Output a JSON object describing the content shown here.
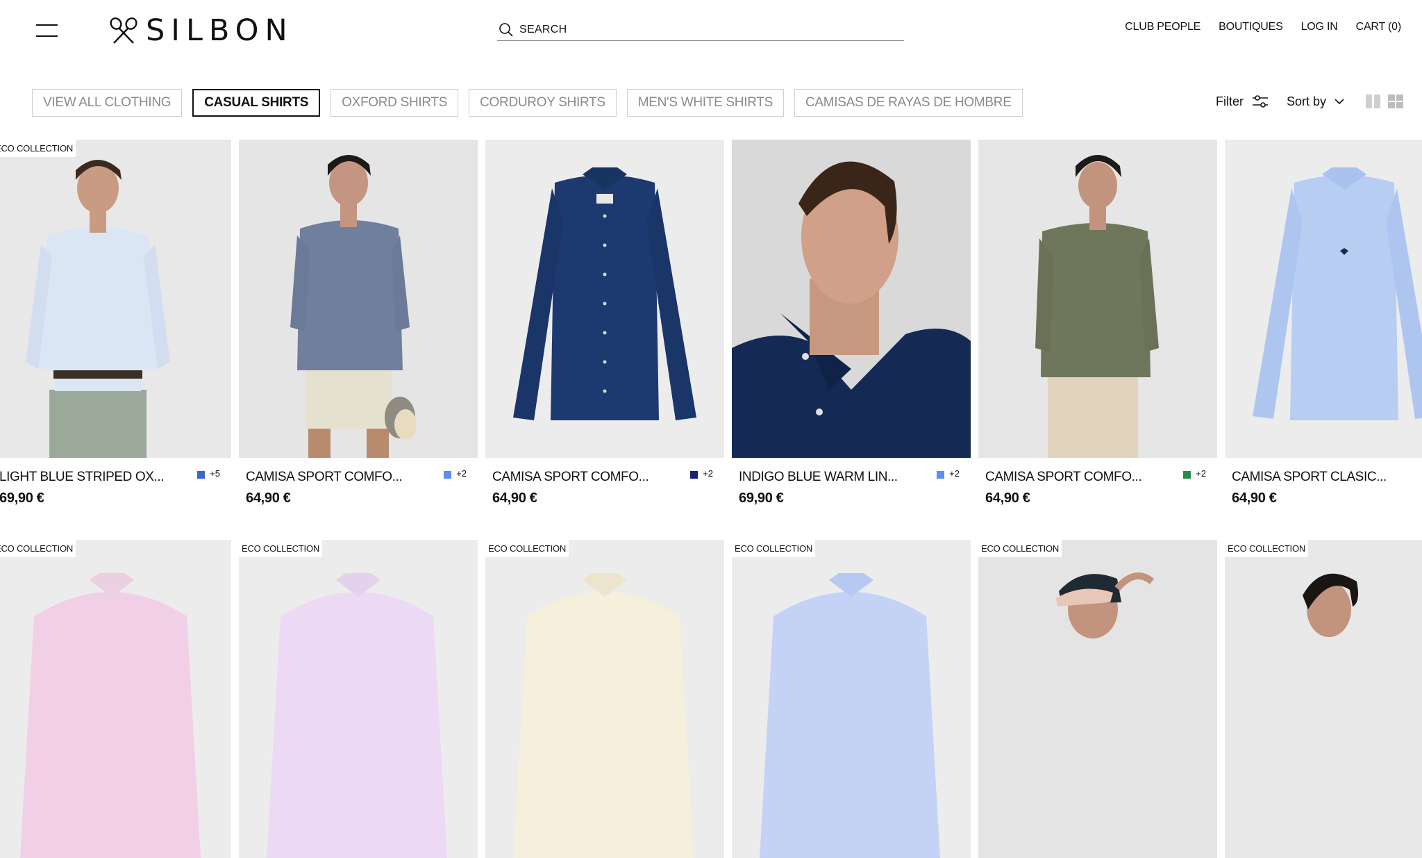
{
  "header": {
    "brand": "SILBON",
    "search_placeholder": "SEARCH",
    "nav": [
      "CLUB PEOPLE",
      "BOUTIQUES",
      "LOG IN",
      "CART (0)"
    ]
  },
  "filters": {
    "tabs": [
      "VIEW ALL CLOTHING",
      "CASUAL SHIRTS",
      "OXFORD SHIRTS",
      "CORDUROY SHIRTS",
      "MEN'S WHITE SHIRTS",
      "CAMISAS DE RAYAS DE HOMBRE"
    ],
    "active_tab": "CASUAL SHIRTS",
    "filter_label": "Filter",
    "sort_label": "Sort by"
  },
  "badge_label": "ECO COLLECTION",
  "products_row1": [
    {
      "name": "LIGHT BLUE STRIPED OX...",
      "price": "69,90 €",
      "swatch": "#3b64d8",
      "more": "+5",
      "badge": true,
      "image": "man-light-blue-striped-shirt"
    },
    {
      "name": "CAMISA SPORT COMFO...",
      "price": "64,90 €",
      "swatch": "#5b8ff0",
      "more": "+2",
      "badge": false,
      "image": "man-blue-linen-shirt-shorts"
    },
    {
      "name": "CAMISA SPORT COMFO...",
      "price": "64,90 €",
      "swatch": "#1a1f70",
      "more": "+2",
      "badge": false,
      "image": "navy-shirt-flatlay"
    },
    {
      "name": "INDIGO BLUE WARM LIN...",
      "price": "69,90 €",
      "swatch": "#5b8ff0",
      "more": "+2",
      "badge": false,
      "image": "man-indigo-shirt-closeup"
    },
    {
      "name": "CAMISA SPORT COMFO...",
      "price": "64,90 €",
      "swatch": "#2e8b47",
      "more": "+2",
      "badge": false,
      "image": "man-olive-shirt"
    },
    {
      "name": "CAMISA SPORT CLASIC...",
      "price": "64,90 €",
      "swatch": "",
      "more": "",
      "badge": false,
      "image": "light-blue-shirt-flatlay"
    }
  ],
  "products_row2": [
    {
      "badge": true,
      "image": "pink-polo-flatlay"
    },
    {
      "badge": true,
      "image": "lilac-polo-flatlay"
    },
    {
      "badge": true,
      "image": "cream-polo-flatlay"
    },
    {
      "badge": true,
      "image": "blue-polo-flatlay"
    },
    {
      "badge": true,
      "image": "man-with-cap"
    },
    {
      "badge": true,
      "image": "man-curly-hair"
    }
  ]
}
